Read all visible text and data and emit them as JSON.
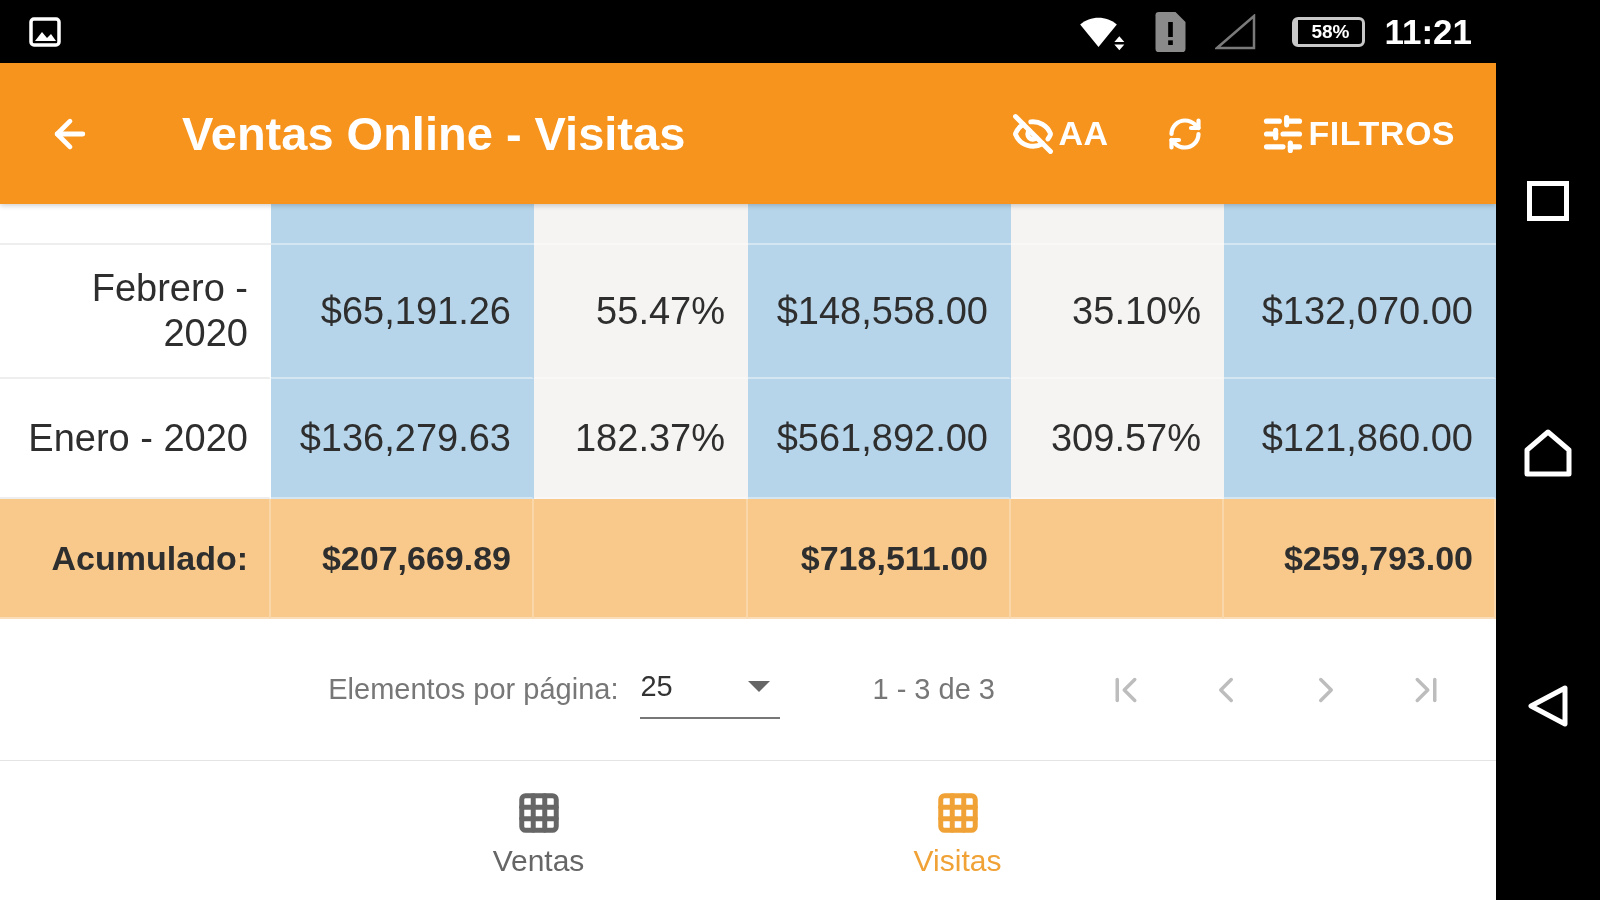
{
  "status_bar": {
    "battery": "58%",
    "time": "11:21"
  },
  "app_bar": {
    "title": "Ventas Online - Visitas",
    "actions": [
      {
        "kind": "hide",
        "label": "AA"
      },
      {
        "kind": "refresh"
      },
      {
        "kind": "filter",
        "label": "FILTROS"
      }
    ]
  },
  "table": {
    "rows": [
      {
        "cells": [
          "Febrero - 2020",
          "$65,191.26",
          "55.47%",
          "$148,558.00",
          "35.10%",
          "$132,070.00"
        ]
      },
      {
        "cells": [
          "Enero - 2020",
          "$136,279.63",
          "182.37%",
          "$561,892.00",
          "309.57%",
          "$121,860.00"
        ]
      }
    ],
    "total": {
      "label": "Acumulado:",
      "amounts": [
        "$207,669.89",
        "$718,511.00",
        "$259,793.00"
      ]
    }
  },
  "pagination": {
    "label": "Elementos por página:",
    "page_size": "25",
    "range": "1 - 3 de 3",
    "buttons": [
      {
        "kind": "first",
        "disabled": true
      },
      {
        "kind": "previous",
        "disabled": true
      },
      {
        "kind": "next",
        "disabled": true
      },
      {
        "kind": "last",
        "disabled": true
      }
    ]
  },
  "bottom_nav": {
    "tabs": [
      {
        "label": "Ventas",
        "selected": false
      },
      {
        "label": "Visitas",
        "selected": true
      }
    ]
  }
}
